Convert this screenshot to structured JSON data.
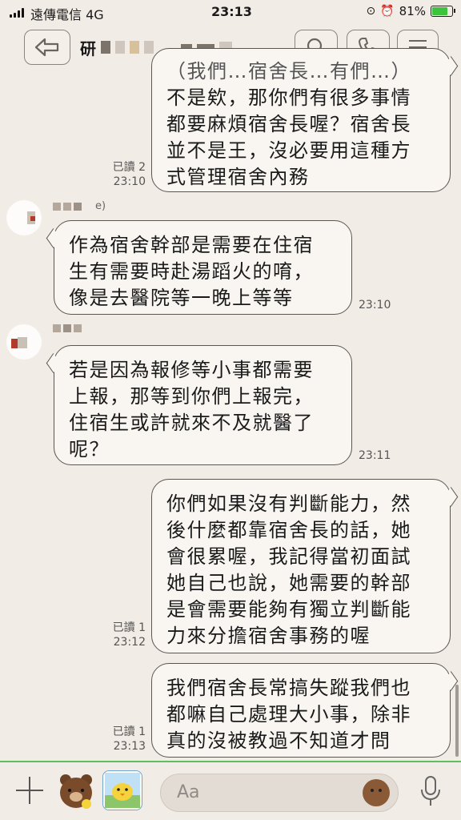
{
  "status": {
    "carrier": "遠傳電信",
    "network": "4G",
    "time": "23:13",
    "battery": "81%",
    "battery_level": 0.81
  },
  "header": {
    "title_initial": "研"
  },
  "messages": [
    {
      "dir": "out",
      "lines": [
        "（我們…宿舍長…有們…）",
        "不是欸，那你們有很多事情",
        "都要麻煩宿舍長喔？宿舍長",
        "並不是王，沒必要用這種方",
        "式管理宿舍內務"
      ],
      "read": "已讀 2",
      "time": "23:10"
    },
    {
      "dir": "in",
      "sender_suffix": "e)",
      "lines": [
        "作為宿舍幹部是需要在住宿",
        "生有需要時赴湯蹈火的唷，",
        "像是去醫院等一晚上等等"
      ],
      "time": "23:10"
    },
    {
      "dir": "in",
      "lines": [
        "若是因為報修等小事都需要",
        "上報，那等到你們上報完，",
        "住宿生或許就來不及就醫了",
        "呢？"
      ],
      "time": "23:11"
    },
    {
      "dir": "out",
      "lines": [
        "你們如果沒有判斷能力，然",
        "後什麼都靠宿舍長的話，她",
        "會很累喔，我記得當初面試",
        "她自己也說，她需要的幹部",
        "是會需要能夠有獨立判斷能",
        "力來分擔宿舍事務的喔"
      ],
      "read": "已讀 1",
      "time": "23:12"
    },
    {
      "dir": "out",
      "lines": [
        "我們宿舍長常搞失蹤我們也",
        "都嘛自己處理大小事，除非",
        "真的沒被教過不知道才問"
      ],
      "read": "已讀 1",
      "time": "23:13"
    }
  ],
  "input": {
    "placeholder": "Aa"
  },
  "colors": {
    "background": "#f1ece5",
    "bubble": "#f9f6f2",
    "bubble_border": "#5b5650",
    "accent_line": "#5fbf60"
  },
  "icons": [
    "back-arrow-icon",
    "search-icon",
    "phone-icon",
    "menu-icon",
    "plus-icon",
    "bear-sticker-icon",
    "chick-sticker-icon",
    "emoji-icon",
    "mic-icon"
  ]
}
